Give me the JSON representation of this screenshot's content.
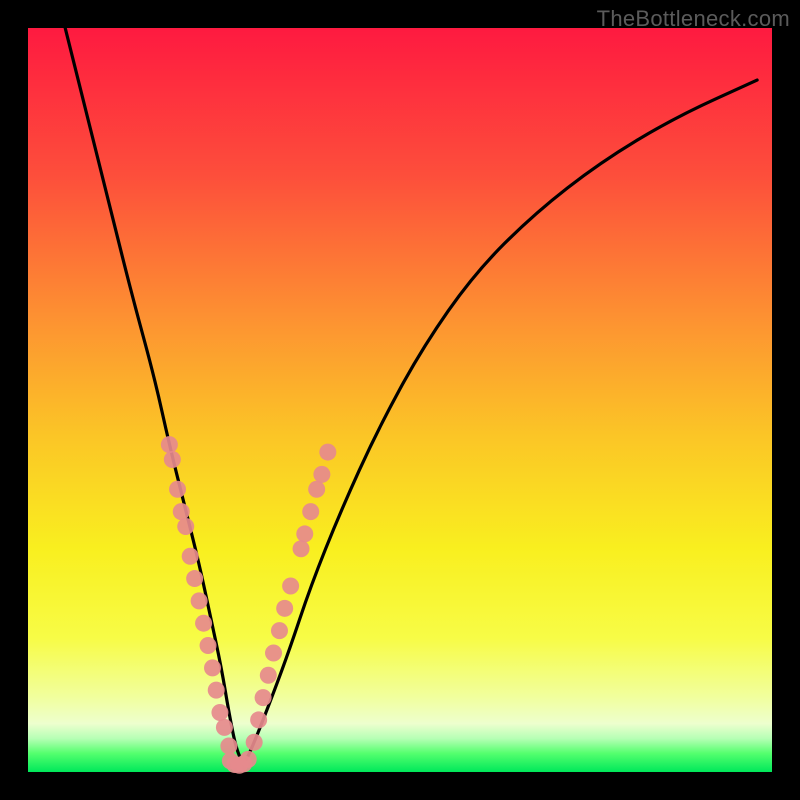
{
  "watermark": "TheBottleneck.com",
  "gradient_stops": [
    {
      "offset": 0.0,
      "color": "#fe1a40"
    },
    {
      "offset": 0.2,
      "color": "#fd4f3b"
    },
    {
      "offset": 0.4,
      "color": "#fd9531"
    },
    {
      "offset": 0.55,
      "color": "#fbc626"
    },
    {
      "offset": 0.7,
      "color": "#f9ef1f"
    },
    {
      "offset": 0.82,
      "color": "#f7fc46"
    },
    {
      "offset": 0.9,
      "color": "#f1ff9e"
    },
    {
      "offset": 0.935,
      "color": "#edffce"
    },
    {
      "offset": 0.955,
      "color": "#b6ffb5"
    },
    {
      "offset": 0.975,
      "color": "#54ff6e"
    },
    {
      "offset": 1.0,
      "color": "#00e85a"
    }
  ],
  "chart_data": {
    "type": "line",
    "title": "",
    "xlabel": "",
    "ylabel": "",
    "xlim": [
      0,
      100
    ],
    "ylim": [
      0,
      100
    ],
    "series": [
      {
        "name": "bottleneck-curve",
        "x": [
          5,
          8,
          11,
          14,
          17,
          19,
          21,
          23,
          24.5,
          26,
          27,
          28,
          29,
          30,
          32,
          35,
          38,
          42,
          47,
          53,
          60,
          68,
          77,
          87,
          98
        ],
        "y": [
          100,
          88,
          76,
          64,
          53,
          44,
          36,
          28,
          21,
          14,
          8,
          3,
          1,
          3,
          8,
          16,
          25,
          35,
          46,
          57,
          67,
          75,
          82,
          88,
          93
        ]
      }
    ],
    "markers": [
      {
        "name": "left-cluster",
        "color": "#e68a8d",
        "points": [
          {
            "x": 19.0,
            "y": 44
          },
          {
            "x": 19.4,
            "y": 42
          },
          {
            "x": 20.1,
            "y": 38
          },
          {
            "x": 20.6,
            "y": 35
          },
          {
            "x": 21.2,
            "y": 33
          },
          {
            "x": 21.8,
            "y": 29
          },
          {
            "x": 22.4,
            "y": 26
          },
          {
            "x": 23.0,
            "y": 23
          },
          {
            "x": 23.6,
            "y": 20
          },
          {
            "x": 24.2,
            "y": 17
          },
          {
            "x": 24.8,
            "y": 14
          },
          {
            "x": 25.3,
            "y": 11
          },
          {
            "x": 25.8,
            "y": 8
          },
          {
            "x": 26.4,
            "y": 6
          },
          {
            "x": 27.0,
            "y": 3.5
          }
        ]
      },
      {
        "name": "bottom-cluster",
        "color": "#e68a8d",
        "points": [
          {
            "x": 27.2,
            "y": 1.5
          },
          {
            "x": 27.8,
            "y": 1.0
          },
          {
            "x": 28.4,
            "y": 0.9
          },
          {
            "x": 29.0,
            "y": 1.1
          },
          {
            "x": 29.6,
            "y": 1.7
          }
        ]
      },
      {
        "name": "right-cluster",
        "color": "#e68a8d",
        "points": [
          {
            "x": 30.4,
            "y": 4
          },
          {
            "x": 31.0,
            "y": 7
          },
          {
            "x": 31.6,
            "y": 10
          },
          {
            "x": 32.3,
            "y": 13
          },
          {
            "x": 33.0,
            "y": 16
          },
          {
            "x": 33.8,
            "y": 19
          },
          {
            "x": 34.5,
            "y": 22
          },
          {
            "x": 35.3,
            "y": 25
          },
          {
            "x": 36.7,
            "y": 30
          },
          {
            "x": 37.2,
            "y": 32
          },
          {
            "x": 38.0,
            "y": 35
          },
          {
            "x": 38.8,
            "y": 38
          },
          {
            "x": 39.5,
            "y": 40
          },
          {
            "x": 40.3,
            "y": 43
          }
        ]
      }
    ]
  }
}
